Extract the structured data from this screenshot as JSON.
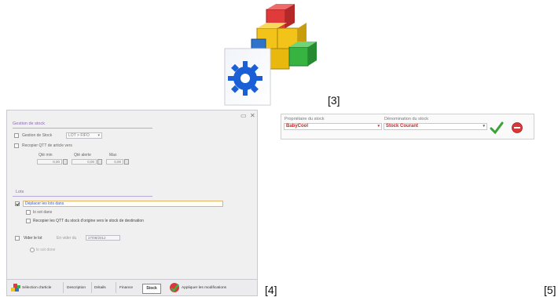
{
  "labels": {
    "l3": "[3]",
    "l4": "[4]",
    "l5": "[5]"
  },
  "icon": {
    "name": "stock-management-app-icon",
    "colors": {
      "cube_red": "#e03a3a",
      "cube_yellow": "#f2c318",
      "cube_green": "#36b341",
      "cube_blue": "#2f74c8",
      "gear": "#1a5fd6"
    }
  },
  "stock_window": {
    "section_stock": "Gestion de stock",
    "gestion_stock_label": "Gestion de Stock",
    "method_value": "LOT > FIFO",
    "recopier_qtt_label": "Recopier QTT de article vers",
    "qte_min_label": "Qté min",
    "qte_alerte_label": "Qté alerte",
    "max_label": "Max",
    "qte_min_value": "0,00",
    "qte_alerte_value": "0,00",
    "max_value": "0,00",
    "section_lots": "Lots",
    "deplacer_lots": "Déplacer les lots dans",
    "lot_sous_label": "lo sot dans",
    "recopier_qtt_origine": "Recopier les QTT du stock d'origine vers le stock de destination",
    "vider_lot_label": "Vider le lot",
    "vider_sub": "En vider du",
    "vider_date": "27/08/2012",
    "lot_done_label": "lo sot done",
    "toolbar": {
      "selection": "Sélection d'article",
      "description": "Description",
      "details": "Détails",
      "finance": "Finance",
      "stock": "Stock",
      "apply": "Appliquer les modifications"
    }
  },
  "owner_window": {
    "owner_label": "Propriétaire du stock",
    "owner_value": "BabyCool",
    "stock_label": "Dénomination du stock",
    "stock_value": "Stock Courant"
  }
}
